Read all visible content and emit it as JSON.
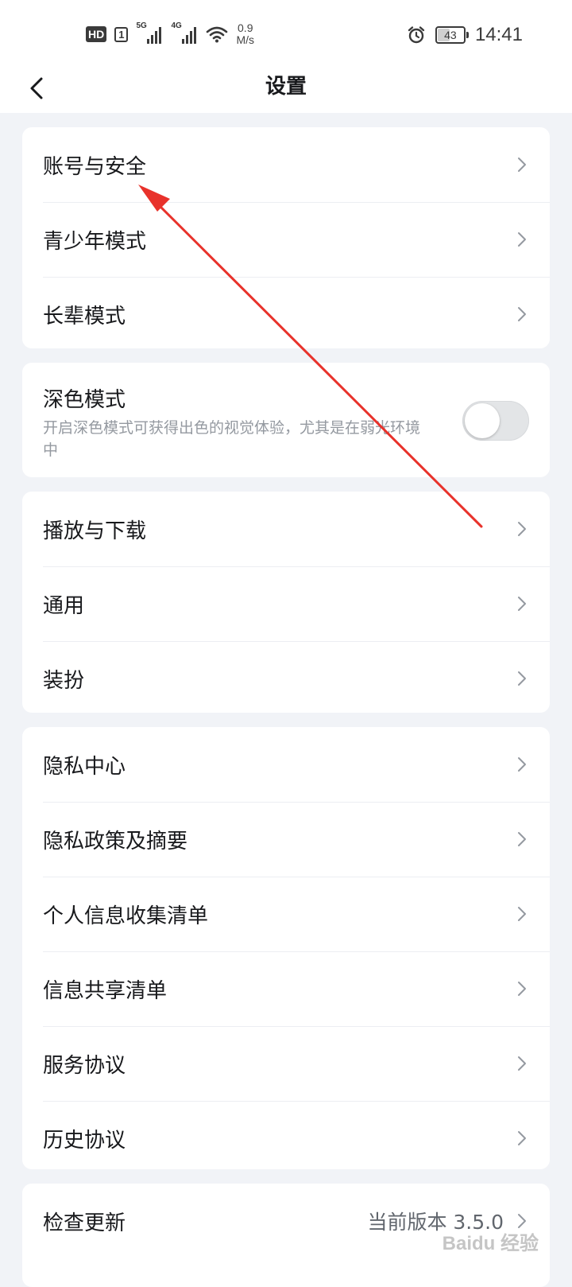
{
  "status_bar": {
    "hd": "HD",
    "sim": "1",
    "net1": "5G",
    "net2": "4G",
    "speed_value": "0.9",
    "speed_unit": "M/s",
    "battery": "43",
    "battery_level": 0.43,
    "time": "14:41",
    "icons": [
      "signal-icon",
      "wifi-icon",
      "alarm-icon",
      "battery-icon"
    ]
  },
  "header": {
    "title": "设置",
    "back_icon": "chevron-left-icon"
  },
  "groups": {
    "account": [
      {
        "label": "账号与安全"
      },
      {
        "label": "青少年模式"
      },
      {
        "label": "长辈模式"
      }
    ],
    "dark_mode": {
      "title": "深色模式",
      "description": "开启深色模式可获得出色的视觉体验，尤其是在弱光环境中",
      "enabled": false
    },
    "media": [
      {
        "label": "播放与下载"
      },
      {
        "label": "通用"
      },
      {
        "label": "装扮"
      }
    ],
    "privacy": [
      {
        "label": "隐私中心"
      },
      {
        "label": "隐私政策及摘要"
      },
      {
        "label": "个人信息收集清单"
      },
      {
        "label": "信息共享清单"
      },
      {
        "label": "服务协议"
      },
      {
        "label": "历史协议"
      }
    ],
    "update": {
      "label": "检查更新",
      "value": "当前版本 3.5.0"
    }
  },
  "annotation": {
    "color": "#e8322b"
  },
  "watermark": "Baidu 经验",
  "colors": {
    "background": "#f1f3f7",
    "card": "#ffffff",
    "text": "#18191c",
    "secondary_text": "#9499a0"
  }
}
